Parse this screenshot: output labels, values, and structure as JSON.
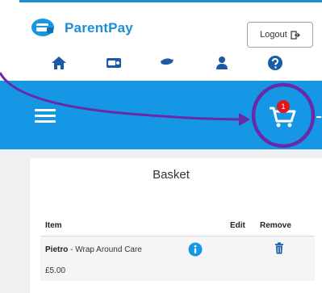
{
  "brand": {
    "name": "ParentPay"
  },
  "header": {
    "logout_label": "Logout"
  },
  "nav": {
    "icons": [
      "home-icon",
      "payment-icon",
      "messages-icon",
      "profile-icon",
      "help-icon"
    ]
  },
  "cart": {
    "count": "1"
  },
  "basket": {
    "title": "Basket",
    "columns": {
      "item": "Item",
      "edit": "Edit",
      "remove": "Remove"
    },
    "items": [
      {
        "child": "Pietro",
        "separator": " - ",
        "description": "Wrap Around Care",
        "price": "£5.00"
      }
    ]
  },
  "colors": {
    "brand_blue": "#1597e5",
    "badge_red": "#e3141a",
    "annotation_purple": "#6a2aa8"
  }
}
